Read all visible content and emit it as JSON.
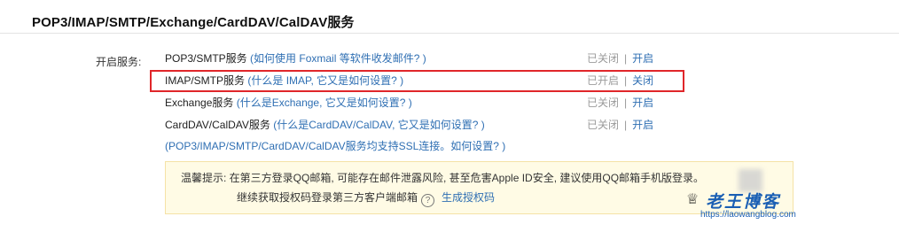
{
  "title": "POP3/IMAP/SMTP/Exchange/CardDAV/CalDAV服务",
  "field_label": "开启服务:",
  "services": [
    {
      "name": "POP3/SMTP服务",
      "help": "(如何使用 Foxmail 等软件收发邮件? )",
      "status": "已关闭",
      "action": "开启"
    },
    {
      "name": "IMAP/SMTP服务",
      "help": "(什么是 IMAP, 它又是如何设置? )",
      "status": "已开启",
      "action": "关闭"
    },
    {
      "name": "Exchange服务",
      "help": "(什么是Exchange, 它又是如何设置? )",
      "status": "已关闭",
      "action": "开启"
    },
    {
      "name": "CardDAV/CalDAV服务",
      "help": "(什么是CardDAV/CalDAV, 它又是如何设置? )",
      "status": "已关闭",
      "action": "开启"
    }
  ],
  "separator": "|",
  "ssl_hint": "(POP3/IMAP/SMTP/CardDAV/CalDAV服务均支持SSL连接。如何设置? )",
  "notice": {
    "line1": "温馨提示: 在第三方登录QQ邮箱, 可能存在邮件泄露风险, 甚至危害Apple ID安全, 建议使用QQ邮箱手机版登录。",
    "line2_prefix": "继续获取授权码登录第三方客户端邮箱",
    "help_icon": "?",
    "generate_link": "生成授权码"
  },
  "watermark": {
    "text": "老王博客",
    "url": "https://laowangblog.com"
  }
}
